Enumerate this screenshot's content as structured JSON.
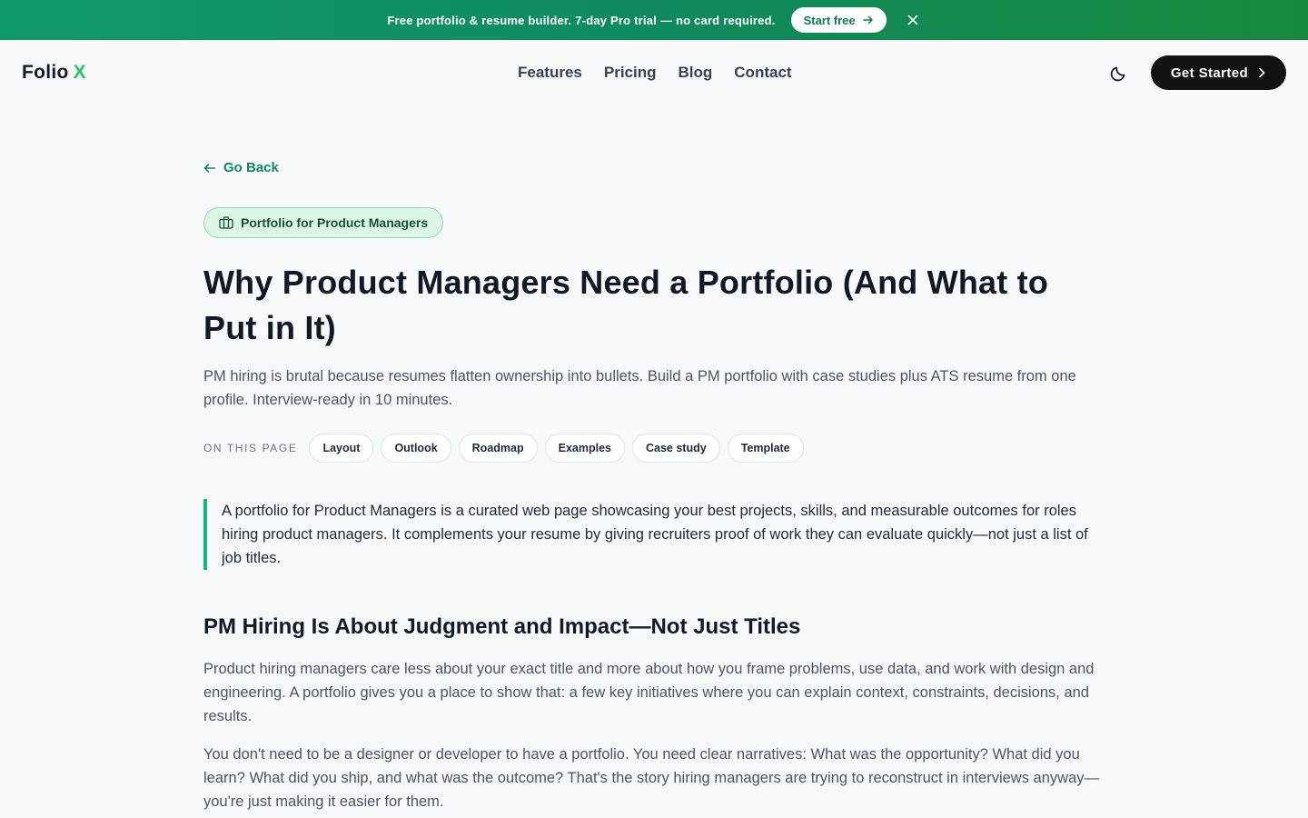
{
  "banner": {
    "text_prefix": "Free portfolio & resume builder.",
    "text_strong": "7-day Pro trial",
    "text_suffix": "— no card required.",
    "button_label": "Start free"
  },
  "nav": {
    "logo_text": "Folio",
    "logo_accent": "X",
    "links": [
      "Features",
      "Pricing",
      "Blog",
      "Contact"
    ],
    "cta_label": "Get Started"
  },
  "article": {
    "back_label": "Go Back",
    "tag_label": "Portfolio for Product Managers",
    "title": "Why Product Managers Need a Portfolio (And What to Put in It)",
    "lead": "PM hiring is brutal because resumes flatten ownership into bullets. Build a PM portfolio with case studies plus ATS resume from one profile. Interview-ready in 10 minutes.",
    "toc_label": "ON THIS PAGE",
    "toc": [
      "Layout",
      "Outlook",
      "Roadmap",
      "Examples",
      "Case study",
      "Template"
    ],
    "quote": "A portfolio for Product Managers is a curated web page showcasing your best projects, skills, and measurable outcomes for roles hiring product managers. It complements your resume by giving recruiters proof of work they can evaluate quickly—not just a list of job titles.",
    "h2": "PM Hiring Is About Judgment and Impact—Not Just Titles",
    "p1": "Product hiring managers care less about your exact title and more about how you frame problems, use data, and work with design and engineering. A portfolio gives you a place to show that: a few key initiatives where you can explain context, constraints, decisions, and results.",
    "p2": "You don't need to be a designer or developer to have a portfolio. You need clear narratives: What was the opportunity? What did you learn? What did you ship, and what was the outcome? That's the story hiring managers are trying to reconstruct in interviews anyway—you're just making it easier for them."
  },
  "colors": {
    "accent": "#0f8a5f",
    "logo_accent": "#22c55e",
    "tag_bg": "#dcf7e6",
    "quote_border": "#10b981"
  },
  "icons": [
    "arrow-right-icon",
    "close-icon",
    "moon-icon",
    "chevron-right-icon",
    "arrow-left-icon",
    "briefcase-icon"
  ]
}
